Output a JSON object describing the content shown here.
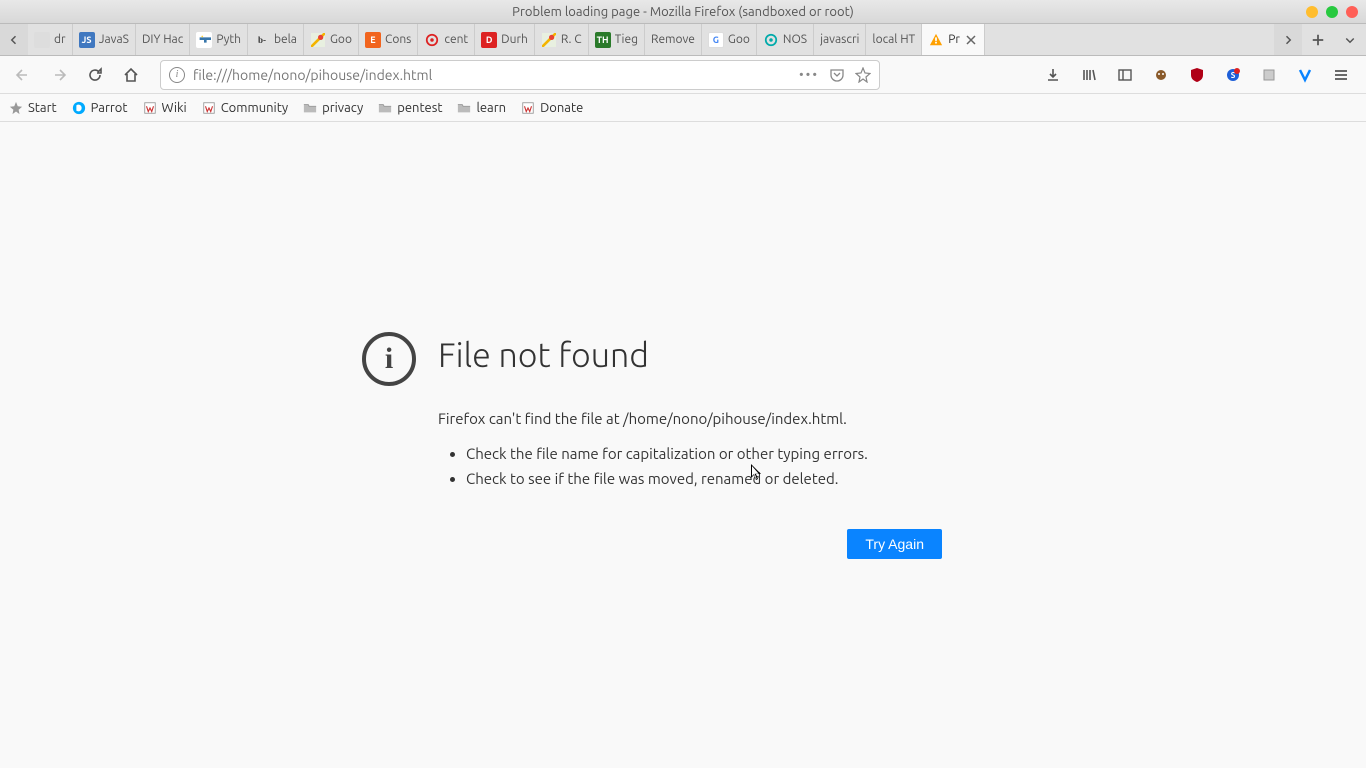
{
  "window": {
    "title": "Problem loading page - Mozilla Firefox (sandboxed or root)"
  },
  "tabs": [
    {
      "label": "dr",
      "favicon": "generic"
    },
    {
      "label": "JavaS",
      "favicon": "js"
    },
    {
      "label": "DIY Hac",
      "favicon": "none"
    },
    {
      "label": "Pyth",
      "favicon": "python"
    },
    {
      "label": "bela",
      "favicon": "bela"
    },
    {
      "label": "Goo",
      "favicon": "gmaps"
    },
    {
      "label": "Cons",
      "favicon": "etsy"
    },
    {
      "label": "cent",
      "favicon": "red"
    },
    {
      "label": "Durh",
      "favicon": "dur"
    },
    {
      "label": "R. C",
      "favicon": "gmaps"
    },
    {
      "label": "Tieg",
      "favicon": "th"
    },
    {
      "label": "Remove",
      "favicon": "none"
    },
    {
      "label": "Goo",
      "favicon": "gt"
    },
    {
      "label": "NOS",
      "favicon": "nos"
    },
    {
      "label": "javascri",
      "favicon": "none"
    },
    {
      "label": "local HT",
      "favicon": "none"
    },
    {
      "label": "Pr",
      "favicon": "warn",
      "active": true
    }
  ],
  "navbar": {
    "url": "file:///home/nono/pihouse/index.html"
  },
  "bookmarks": [
    {
      "label": "Start",
      "icon": "star"
    },
    {
      "label": "Parrot",
      "icon": "parrot"
    },
    {
      "label": "Wiki",
      "icon": "wiki"
    },
    {
      "label": "Community",
      "icon": "wiki"
    },
    {
      "label": "privacy",
      "icon": "folder"
    },
    {
      "label": "pentest",
      "icon": "folder"
    },
    {
      "label": "learn",
      "icon": "folder"
    },
    {
      "label": "Donate",
      "icon": "wiki"
    }
  ],
  "error": {
    "title": "File not found",
    "description": "Firefox can't find the file at /home/nono/pihouse/index.html.",
    "suggestions": [
      "Check the file name for capitalization or other typing errors.",
      "Check to see if the file was moved, renamed or deleted."
    ],
    "try_again": "Try Again"
  }
}
